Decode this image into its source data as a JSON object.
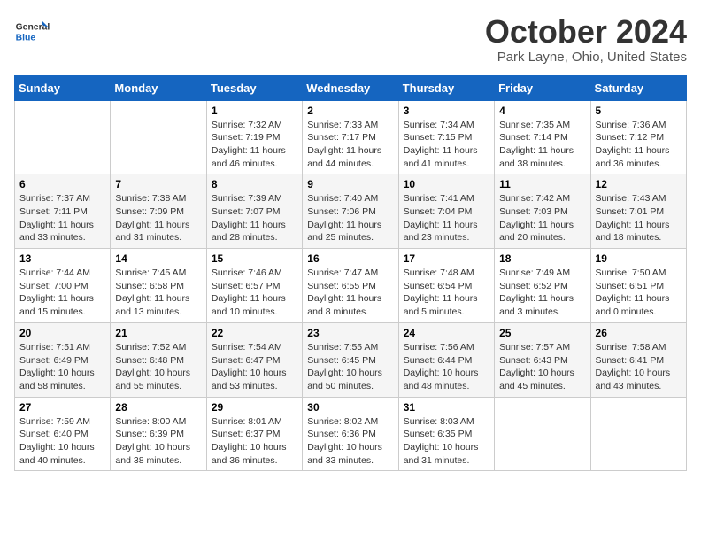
{
  "header": {
    "logo_general": "General",
    "logo_blue": "Blue",
    "month_title": "October 2024",
    "location": "Park Layne, Ohio, United States"
  },
  "days_of_week": [
    "Sunday",
    "Monday",
    "Tuesday",
    "Wednesday",
    "Thursday",
    "Friday",
    "Saturday"
  ],
  "weeks": [
    [
      {
        "day": "",
        "info": ""
      },
      {
        "day": "",
        "info": ""
      },
      {
        "day": "1",
        "sunrise": "7:32 AM",
        "sunset": "7:19 PM",
        "daylight": "11 hours and 46 minutes."
      },
      {
        "day": "2",
        "sunrise": "7:33 AM",
        "sunset": "7:17 PM",
        "daylight": "11 hours and 44 minutes."
      },
      {
        "day": "3",
        "sunrise": "7:34 AM",
        "sunset": "7:15 PM",
        "daylight": "11 hours and 41 minutes."
      },
      {
        "day": "4",
        "sunrise": "7:35 AM",
        "sunset": "7:14 PM",
        "daylight": "11 hours and 38 minutes."
      },
      {
        "day": "5",
        "sunrise": "7:36 AM",
        "sunset": "7:12 PM",
        "daylight": "11 hours and 36 minutes."
      }
    ],
    [
      {
        "day": "6",
        "sunrise": "7:37 AM",
        "sunset": "7:11 PM",
        "daylight": "11 hours and 33 minutes."
      },
      {
        "day": "7",
        "sunrise": "7:38 AM",
        "sunset": "7:09 PM",
        "daylight": "11 hours and 31 minutes."
      },
      {
        "day": "8",
        "sunrise": "7:39 AM",
        "sunset": "7:07 PM",
        "daylight": "11 hours and 28 minutes."
      },
      {
        "day": "9",
        "sunrise": "7:40 AM",
        "sunset": "7:06 PM",
        "daylight": "11 hours and 25 minutes."
      },
      {
        "day": "10",
        "sunrise": "7:41 AM",
        "sunset": "7:04 PM",
        "daylight": "11 hours and 23 minutes."
      },
      {
        "day": "11",
        "sunrise": "7:42 AM",
        "sunset": "7:03 PM",
        "daylight": "11 hours and 20 minutes."
      },
      {
        "day": "12",
        "sunrise": "7:43 AM",
        "sunset": "7:01 PM",
        "daylight": "11 hours and 18 minutes."
      }
    ],
    [
      {
        "day": "13",
        "sunrise": "7:44 AM",
        "sunset": "7:00 PM",
        "daylight": "11 hours and 15 minutes."
      },
      {
        "day": "14",
        "sunrise": "7:45 AM",
        "sunset": "6:58 PM",
        "daylight": "11 hours and 13 minutes."
      },
      {
        "day": "15",
        "sunrise": "7:46 AM",
        "sunset": "6:57 PM",
        "daylight": "11 hours and 10 minutes."
      },
      {
        "day": "16",
        "sunrise": "7:47 AM",
        "sunset": "6:55 PM",
        "daylight": "11 hours and 8 minutes."
      },
      {
        "day": "17",
        "sunrise": "7:48 AM",
        "sunset": "6:54 PM",
        "daylight": "11 hours and 5 minutes."
      },
      {
        "day": "18",
        "sunrise": "7:49 AM",
        "sunset": "6:52 PM",
        "daylight": "11 hours and 3 minutes."
      },
      {
        "day": "19",
        "sunrise": "7:50 AM",
        "sunset": "6:51 PM",
        "daylight": "11 hours and 0 minutes."
      }
    ],
    [
      {
        "day": "20",
        "sunrise": "7:51 AM",
        "sunset": "6:49 PM",
        "daylight": "10 hours and 58 minutes."
      },
      {
        "day": "21",
        "sunrise": "7:52 AM",
        "sunset": "6:48 PM",
        "daylight": "10 hours and 55 minutes."
      },
      {
        "day": "22",
        "sunrise": "7:54 AM",
        "sunset": "6:47 PM",
        "daylight": "10 hours and 53 minutes."
      },
      {
        "day": "23",
        "sunrise": "7:55 AM",
        "sunset": "6:45 PM",
        "daylight": "10 hours and 50 minutes."
      },
      {
        "day": "24",
        "sunrise": "7:56 AM",
        "sunset": "6:44 PM",
        "daylight": "10 hours and 48 minutes."
      },
      {
        "day": "25",
        "sunrise": "7:57 AM",
        "sunset": "6:43 PM",
        "daylight": "10 hours and 45 minutes."
      },
      {
        "day": "26",
        "sunrise": "7:58 AM",
        "sunset": "6:41 PM",
        "daylight": "10 hours and 43 minutes."
      }
    ],
    [
      {
        "day": "27",
        "sunrise": "7:59 AM",
        "sunset": "6:40 PM",
        "daylight": "10 hours and 40 minutes."
      },
      {
        "day": "28",
        "sunrise": "8:00 AM",
        "sunset": "6:39 PM",
        "daylight": "10 hours and 38 minutes."
      },
      {
        "day": "29",
        "sunrise": "8:01 AM",
        "sunset": "6:37 PM",
        "daylight": "10 hours and 36 minutes."
      },
      {
        "day": "30",
        "sunrise": "8:02 AM",
        "sunset": "6:36 PM",
        "daylight": "10 hours and 33 minutes."
      },
      {
        "day": "31",
        "sunrise": "8:03 AM",
        "sunset": "6:35 PM",
        "daylight": "10 hours and 31 minutes."
      },
      {
        "day": "",
        "info": ""
      },
      {
        "day": "",
        "info": ""
      }
    ]
  ]
}
